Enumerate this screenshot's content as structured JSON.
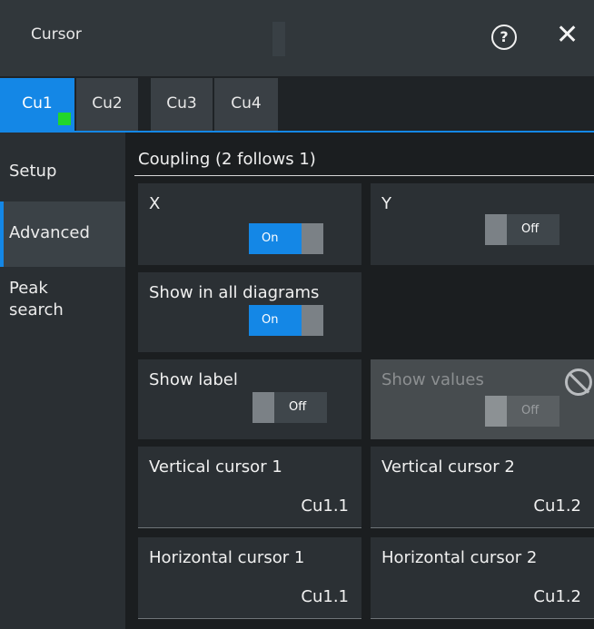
{
  "window": {
    "title": "Cursor"
  },
  "tabs": [
    {
      "label": "Cu1",
      "active": true,
      "indicator_color": "#22d62b"
    },
    {
      "label": "Cu2"
    },
    {
      "label": "Cu3"
    },
    {
      "label": "Cu4"
    }
  ],
  "sidebar": {
    "items": [
      {
        "label": "Setup"
      },
      {
        "label": "Advanced",
        "active": true
      },
      {
        "label": "Peak search"
      }
    ]
  },
  "coupling": {
    "title": "Coupling (2 follows 1)",
    "x": {
      "label": "X",
      "state": "On"
    },
    "y": {
      "label": "Y",
      "state": "Off"
    }
  },
  "show_all_diagrams": {
    "label": "Show in all diagrams",
    "state": "On"
  },
  "show_label": {
    "label": "Show label",
    "state": "Off"
  },
  "show_values": {
    "label": "Show values",
    "state": "Off",
    "disabled": true
  },
  "vertical_cursor_1": {
    "label": "Vertical cursor 1",
    "value": "Cu1.1"
  },
  "vertical_cursor_2": {
    "label": "Vertical cursor 2",
    "value": "Cu1.2"
  },
  "horizontal_cursor_1": {
    "label": "Horizontal cursor 1",
    "value": "Cu1.1"
  },
  "horizontal_cursor_2": {
    "label": "Horizontal cursor 2",
    "value": "Cu1.2"
  },
  "colors": {
    "accent": "#1487e6",
    "indicator": "#22d62b"
  }
}
